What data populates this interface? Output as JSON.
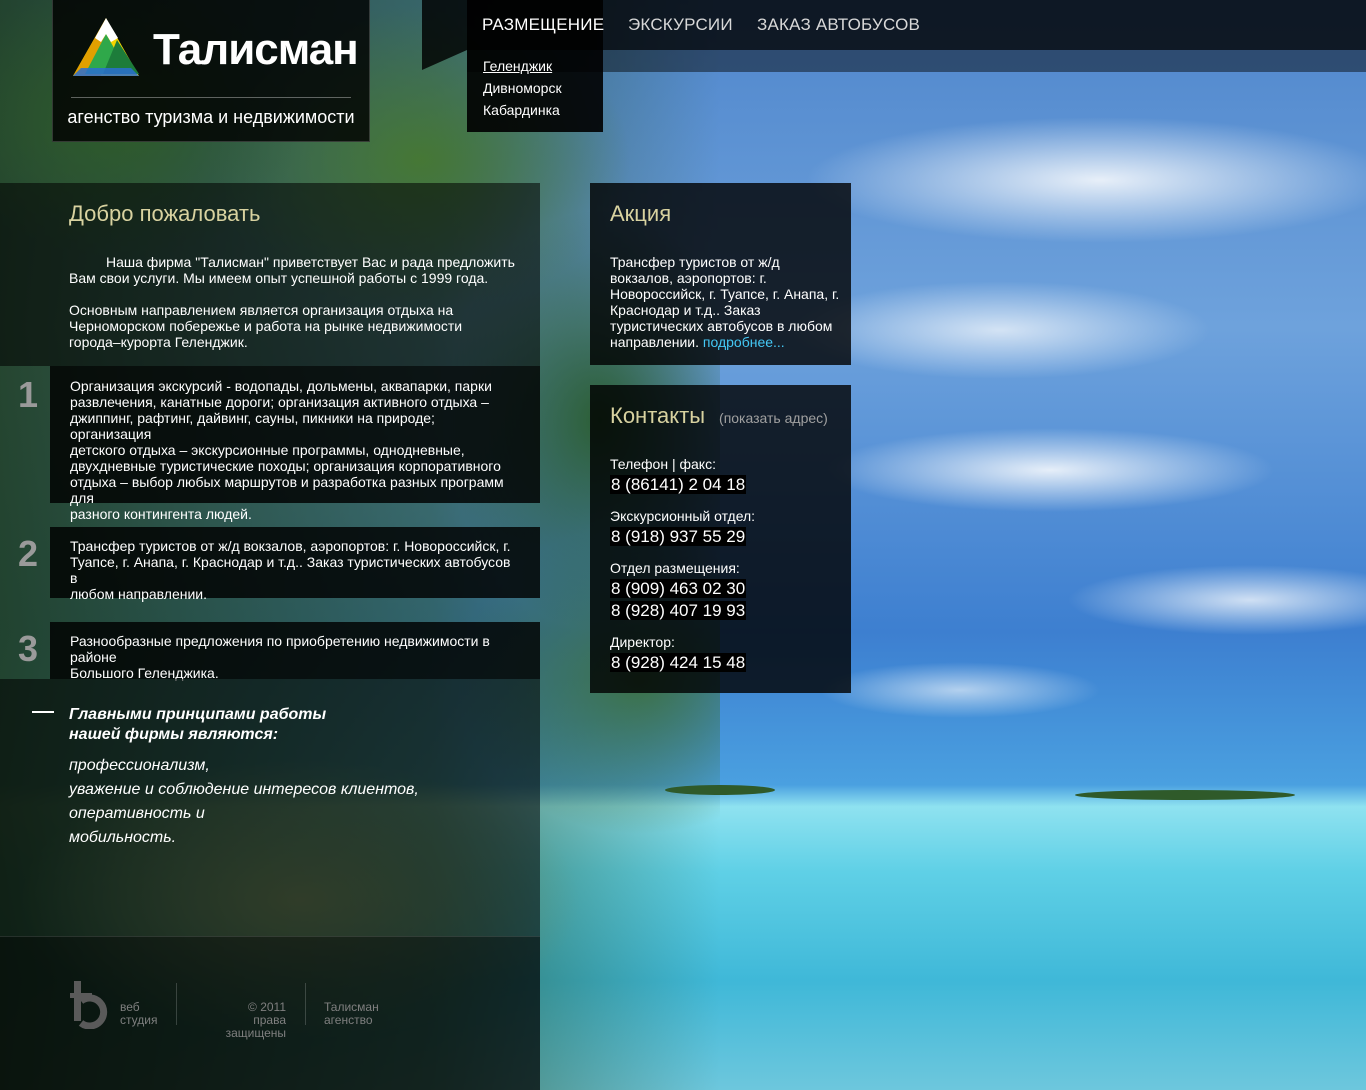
{
  "logo": {
    "name": "Талисман",
    "tagline": "агенство туризма и недвижимости"
  },
  "nav": {
    "items": [
      "РАЗМЕЩЕНИЕ",
      "ЭКСКУРСИИ",
      "ЗАКАЗ АВТОБУСОВ"
    ],
    "dropdown": [
      "Геленджик",
      "Дивноморск",
      "Кабардинка"
    ]
  },
  "welcome": {
    "title": "Добро пожаловать",
    "p1a": "Наша фирма \"Талисман\" приветствует Вас и рада предложить",
    "p1b": "Вам свои услуги. Мы имеем опыт успешной работы с 1999 года.",
    "p2a": "Основным направлением является организация отдыха на",
    "p2b": "Черноморском побережье и работа на рынке недвижимости",
    "p2c": "города–курорта Геленджик."
  },
  "services": [
    {
      "num": "1",
      "lines": [
        "Организация экскурсий - водопады, дольмены, аквапарки, парки",
        "развлечения, канатные дороги; организация активного отдыха –",
        "джиппинг, рафтинг, дайвинг, сауны, пикники на природе; организация",
        "детского отдыха – экскурсионные программы, однодневные,",
        "двухдневные туристические походы; организация корпоративного",
        "отдыха – выбор любых маршрутов и разработка разных программ для",
        "разного контингента людей."
      ]
    },
    {
      "num": "2",
      "lines": [
        "Трансфер туристов от ж/д вокзалов, аэропортов: г. Новороссийск, г.",
        "Туапсе, г. Анапа, г. Краснодар и т.д.. Заказ туристических автобусов в",
        "любом направлении."
      ]
    },
    {
      "num": "3",
      "lines": [
        "Разнообразные предложения по приобретению недвижимости в районе",
        "Большого Геленджика."
      ]
    }
  ],
  "principles": {
    "head1": "Главными принципами работы",
    "head2": "нашей фирмы являются:",
    "items": [
      "профессионализм,",
      "уважение и соблюдение интересов клиентов,",
      "оперативность и",
      "мобильность."
    ]
  },
  "footer": {
    "studio1": "веб",
    "studio2": "студия",
    "copy1": "© 2011",
    "copy2": "права защищены",
    "agency1": "Талисман",
    "agency2": "агенство"
  },
  "promo": {
    "title": "Акция",
    "lines": [
      "Трансфер туристов от ж/д",
      "вокзалов, аэропортов: г.",
      "Новороссийск, г. Туапсе, г. Анапа, г.",
      "Краснодар и т.д.. Заказ",
      "туристических автобусов в любом"
    ],
    "last": "направлении.",
    "more": "подробнее..."
  },
  "contacts": {
    "title": "Контакты",
    "show_address": "(показать адрес)",
    "tel_label": "Телефон | факс:",
    "tel": "8 (86141) 2 04 18",
    "exc_label": "Экскурсионный отдел:",
    "exc": "8 (918) 937 55 29",
    "acc_label": "Отдел размещения:",
    "acc1": "8 (909) 463 02 30",
    "acc2": "8 (928) 407 19 93",
    "dir_label": "Директор:",
    "dir": "8 (928) 424 15 48"
  },
  "colors": {
    "heading": "#d8d2a0",
    "link": "#44c8f5"
  }
}
